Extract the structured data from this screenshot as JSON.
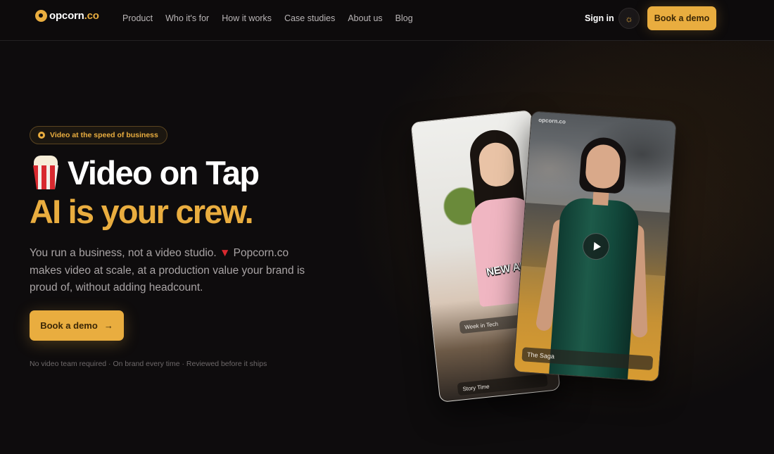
{
  "brand": {
    "logo_text": "opcorn",
    "logo_suffix": ".co",
    "accent_color": "#e9ad3f"
  },
  "nav": {
    "links": [
      "Product",
      "Who it's for",
      "How it works",
      "Case studies",
      "About us",
      "Blog"
    ],
    "sign_in": "Sign in",
    "theme_icon": "sun-icon",
    "demo_label": "Book a demo"
  },
  "hero": {
    "badge": "Video at the speed of business",
    "headline": "Video on Tap",
    "subheadline": "AI is your crew.",
    "description_prefix": "You run a business, not a video studio. ",
    "description_suffix": " Popcorn.co makes video at scale, at a production value your brand is proud of, without adding headcount.",
    "cta_label": "Book a demo",
    "cta_arrow": "→",
    "fine_print": "No video team required · On brand every time · Reviewed before it ships"
  },
  "cards": {
    "back": {
      "overlay_text": "NEW AI",
      "tag_top": "Week in Tech",
      "tag_bottom": "Story Time"
    },
    "front": {
      "logo": "opcorn.co",
      "tag": "The Saga",
      "play_icon": "play-icon"
    }
  }
}
